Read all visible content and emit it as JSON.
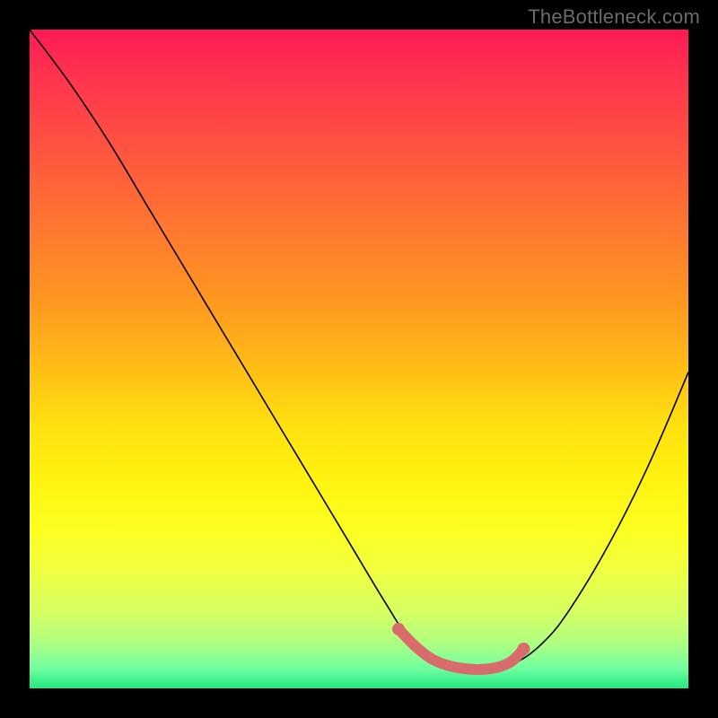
{
  "watermark": "TheBottleneck.com",
  "chart_data": {
    "type": "line",
    "title": "",
    "xlabel": "",
    "ylabel": "",
    "xlim": [
      0,
      100
    ],
    "ylim": [
      0,
      100
    ],
    "series": [
      {
        "name": "bottleneck-curve",
        "x": [
          0,
          6,
          12,
          18,
          24,
          30,
          36,
          42,
          48,
          54,
          58,
          62,
          66,
          70,
          74,
          78,
          82,
          88,
          94,
          100
        ],
        "values": [
          100,
          92,
          83,
          73,
          63,
          53,
          43,
          33,
          23,
          13,
          7,
          4,
          3,
          3,
          4,
          7,
          12,
          22,
          34,
          48
        ]
      },
      {
        "name": "optimal-highlight",
        "x": [
          56,
          59,
          62,
          66,
          70,
          73,
          75
        ],
        "values": [
          9,
          6,
          4,
          3,
          3,
          4,
          6
        ]
      }
    ],
    "highlight_color": "#d86b6b"
  }
}
